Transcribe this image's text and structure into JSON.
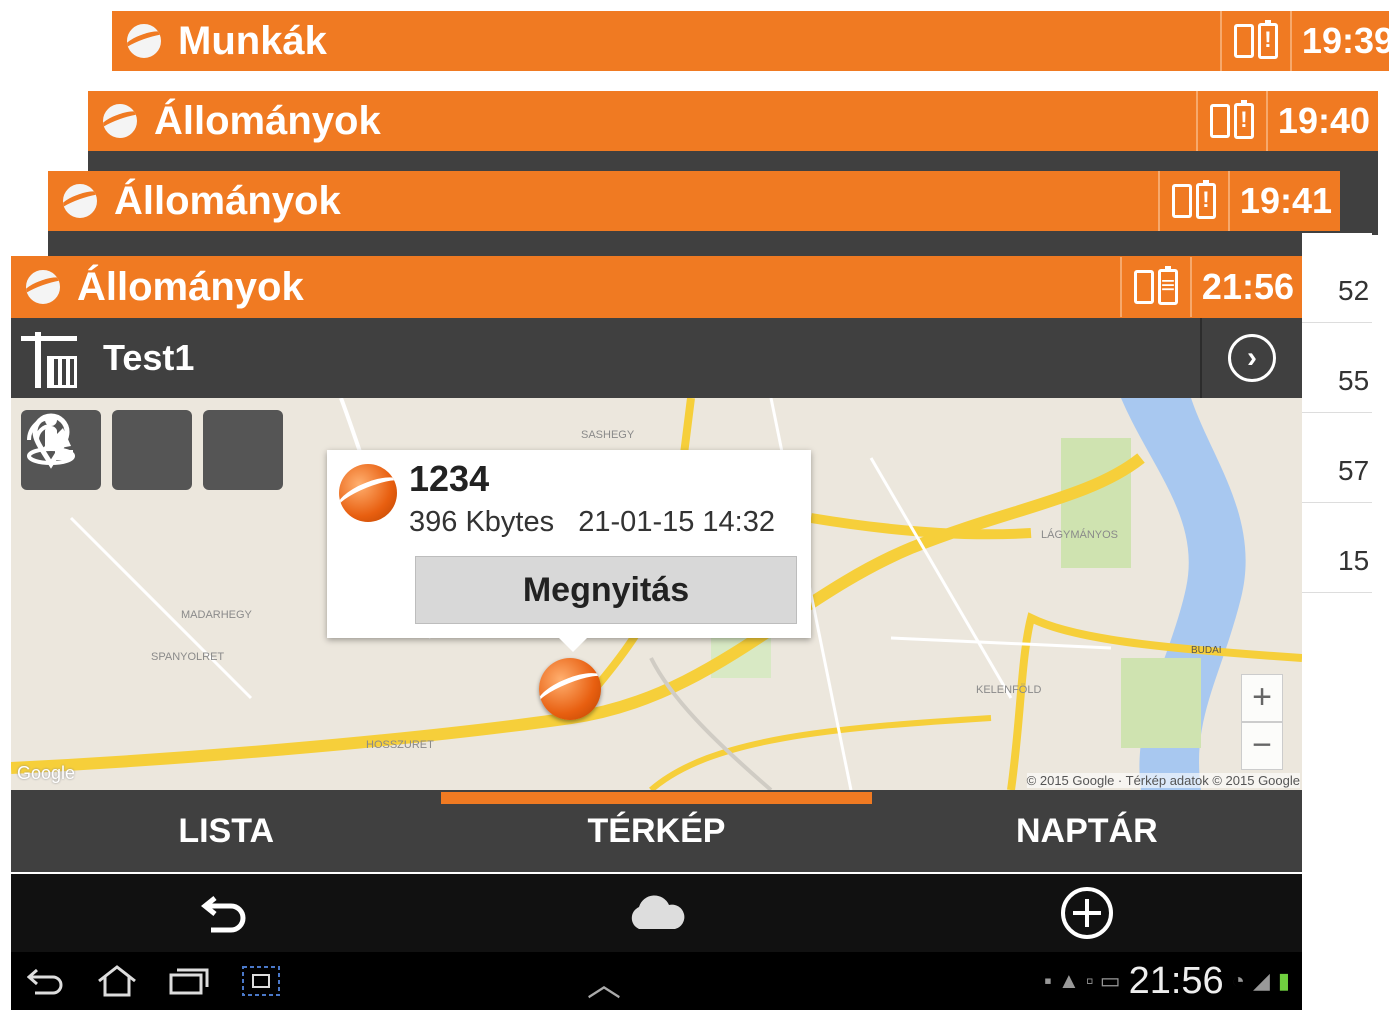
{
  "windows": [
    {
      "title": "Munkák",
      "time": "19:39"
    },
    {
      "title": "Állományok",
      "time": "19:40"
    },
    {
      "title": "Állományok",
      "time": "19:41"
    }
  ],
  "side_values": [
    "52",
    "55",
    "57",
    "15"
  ],
  "main": {
    "title": "Állományok",
    "time": "21:56",
    "project_name": "Test1",
    "map_buttons": [
      "signal-icon",
      "location-pin-icon",
      "person-location-icon"
    ],
    "popup": {
      "name": "1234",
      "info": "396 Kbytes   21-01-15 14:32",
      "open_label": "Megnyitás"
    },
    "zoom_in": "+",
    "zoom_out": "−",
    "map_copyright": "© 2015 Google · Térkép adatok © 2015 Google",
    "map_logo": "Google",
    "map_places": [
      "SASHEGY",
      "MADARHEGY",
      "SPANYOLRET",
      "HOSSZURET",
      "LÁGYMÁNYOS",
      "KELENFÖLD",
      "BUDAI"
    ],
    "tabs": [
      "LISTA",
      "TÉRKÉP",
      "NAPTÁR"
    ],
    "active_tab": "TÉRKÉP",
    "system_time": "21:56"
  },
  "colors": {
    "accent": "#f07a22",
    "bar": "#404040",
    "river": "#a8c8f0",
    "road": "#f6cf3a"
  }
}
